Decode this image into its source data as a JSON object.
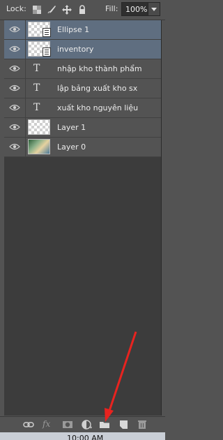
{
  "lock_bar": {
    "lock_label": "Lock:",
    "fill_label": "Fill:",
    "fill_value": "100%",
    "lock_icons": [
      "lock-transparent-pixels-icon",
      "lock-image-pixels-icon",
      "lock-position-icon",
      "lock-all-icon"
    ]
  },
  "layers": [
    {
      "name": "Ellipse 1",
      "kind": "shape",
      "selected": true,
      "visible": true
    },
    {
      "name": "inventory",
      "kind": "shape",
      "selected": true,
      "visible": true
    },
    {
      "name": "nhập kho thành phẩm",
      "kind": "text",
      "selected": false,
      "visible": true
    },
    {
      "name": "lập bảng xuất kho sx",
      "kind": "text",
      "selected": false,
      "visible": true
    },
    {
      "name": "xuất kho nguyên liệu",
      "kind": "text",
      "selected": false,
      "visible": true
    },
    {
      "name": "Layer 1",
      "kind": "pixel",
      "selected": false,
      "visible": true
    },
    {
      "name": "Layer 0",
      "kind": "image",
      "selected": false,
      "visible": true
    }
  ],
  "toolbar": {
    "icons": [
      "link-layers-icon",
      "fx-icon",
      "add-mask-icon",
      "adjustment-layer-icon",
      "new-group-folder-icon",
      "new-layer-icon",
      "delete-trash-icon"
    ],
    "fx_label": "fx"
  },
  "taskbar": {
    "clock": "10:00 AM"
  },
  "colors": {
    "panel": "#535353",
    "selected_row": "#5f6e80",
    "annotation_arrow": "#e8231f"
  }
}
